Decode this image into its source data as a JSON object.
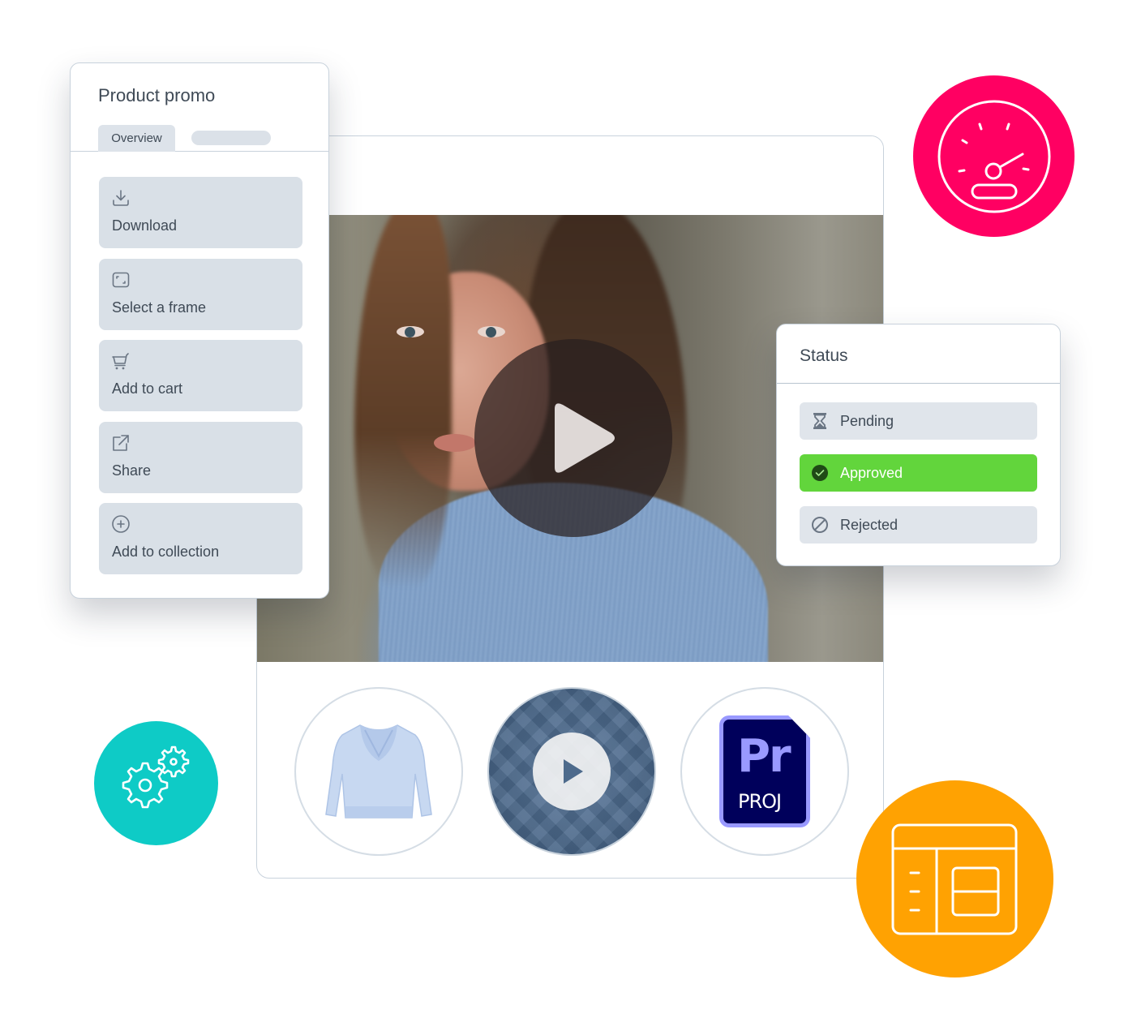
{
  "product_panel": {
    "title": "Product promo",
    "tabs": [
      {
        "label": "Overview",
        "active": true
      },
      {
        "label": "",
        "active": false
      }
    ],
    "actions": [
      {
        "label": "Download",
        "icon": "download-icon"
      },
      {
        "label": "Select a frame",
        "icon": "frame-icon"
      },
      {
        "label": "Add to cart",
        "icon": "cart-icon"
      },
      {
        "label": "Share",
        "icon": "share-icon"
      },
      {
        "label": "Add to collection",
        "icon": "plus-circle-icon"
      }
    ]
  },
  "media": {
    "hero_description": "Portrait of woman in blue knit sweater (video)",
    "play_icon": "play-icon",
    "thumbnails": [
      {
        "type": "image",
        "description": "Light blue cowl-neck sweater"
      },
      {
        "type": "video",
        "description": "Blue knit fabric texture"
      },
      {
        "type": "file",
        "app": "Pr",
        "ext": "PROJ"
      }
    ]
  },
  "status_panel": {
    "title": "Status",
    "options": [
      {
        "label": "Pending",
        "icon": "hourglass-icon",
        "selected": false
      },
      {
        "label": "Approved",
        "icon": "check-circle-icon",
        "selected": true
      },
      {
        "label": "Rejected",
        "icon": "prohibited-icon",
        "selected": false
      }
    ]
  },
  "badges": [
    {
      "icon": "speedometer-icon",
      "color": "#ff0062"
    },
    {
      "icon": "gears-icon",
      "color": "#0ecbc6"
    },
    {
      "icon": "layout-icon",
      "color": "#ffa202"
    }
  ],
  "colors": {
    "approved": "#62d53c",
    "button_bg": "#d9e0e7",
    "text": "#3f4a56",
    "premiere_dark": "#00005b",
    "premiere_light": "#9999ff"
  }
}
